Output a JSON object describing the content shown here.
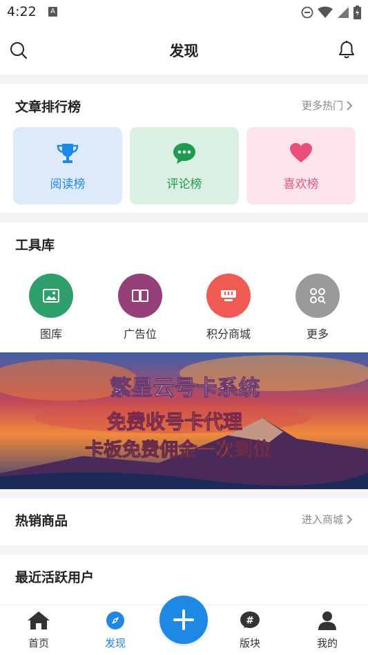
{
  "status_bar": {
    "time": "4:22",
    "notification_icon": "A"
  },
  "header": {
    "title": "发现"
  },
  "ranking": {
    "title": "文章排行榜",
    "more": "更多热门",
    "items": [
      {
        "label": "阅读榜",
        "icon": "trophy-icon",
        "color": "#1e88e5",
        "bg": "#ddeafa"
      },
      {
        "label": "评论榜",
        "icon": "chat-icon",
        "color": "#1e9b4e",
        "bg": "#dcefe3"
      },
      {
        "label": "喜欢榜",
        "icon": "heart-icon",
        "color": "#e8557a",
        "bg": "#fde4ea"
      }
    ]
  },
  "tools": {
    "title": "工具库",
    "items": [
      {
        "label": "图库",
        "icon": "image-icon",
        "color": "#2e9e6b"
      },
      {
        "label": "广告位",
        "icon": "book-icon",
        "color": "#96407a"
      },
      {
        "label": "积分商城",
        "icon": "store-icon",
        "color": "#ef5a52"
      },
      {
        "label": "更多",
        "icon": "grid-search-icon",
        "color": "#9a9a9a"
      }
    ]
  },
  "banner": {
    "line1": "繁星云号卡系统",
    "line2": "免费收号卡代理",
    "line3": "卡板免费佣金一次到位"
  },
  "hot_goods": {
    "title": "热销商品",
    "more": "进入商城"
  },
  "active_users": {
    "title": "最近活跃用户"
  },
  "tabbar": {
    "items": [
      {
        "label": "首页",
        "icon": "home-icon"
      },
      {
        "label": "发现",
        "icon": "compass-icon",
        "active": true
      },
      {
        "label": "版块",
        "icon": "hashtag-icon"
      },
      {
        "label": "我的",
        "icon": "user-icon"
      }
    ],
    "fab_icon": "plus-icon",
    "active_color": "#1e88e5"
  }
}
